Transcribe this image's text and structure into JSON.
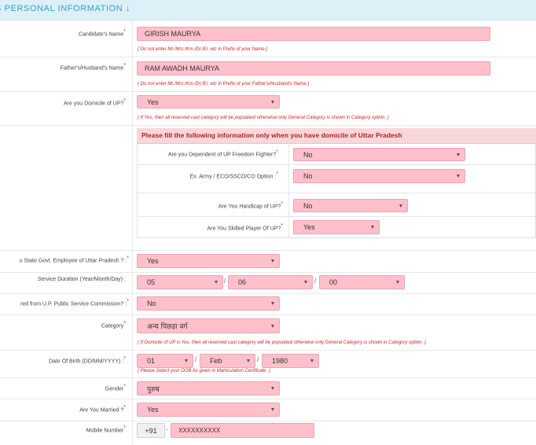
{
  "header": {
    "title": "S PERSONAL INFORMATION ↓"
  },
  "required_mark": "*",
  "candidate_name": {
    "label": "Candidate's Name",
    "value": "GIRISH MAURYA",
    "note": "( Do not enter Mr./Mrs./Km./Dr./Er. etc  in Prefix of your Name.)"
  },
  "father_name": {
    "label": "Father's/Husband's Name",
    "value": "RAM AWADH MAURYA",
    "note": "( Do not enter Mr./Mrs./Km./Dr./Er. etc  in Prefix of your Father's/Husband's Name.)"
  },
  "domicile": {
    "label": "Are you Domicile of UP?",
    "value": "Yes",
    "note": "( If Yes, then all reserved cast category will be populated otherwise only General Category is shown in Category option. )"
  },
  "domicile_panel": {
    "title": "Please fill the following information only when you have domicile of Uttar Pradesh",
    "freedom_fighter": {
      "label": "Are you Dependent of UP Freedom Fighter?",
      "value": "No"
    },
    "ex_army": {
      "label": "Ex. Army / ECO/SSCO/CO Option :",
      "value": "No"
    },
    "handicap": {
      "label": "Are You Handicap of UP?",
      "value": "No"
    },
    "skilled_player": {
      "label": "Are You Skilled Player Of UP?",
      "value": "Yes"
    }
  },
  "state_employee": {
    "label": "u State Govt. Employee of Uttar Pradesh ? :",
    "value": "Yes"
  },
  "service_duration": {
    "label": "Service Duration (Year/Month/Day) :",
    "year": "05",
    "month": "06",
    "day": "00",
    "sep": "/"
  },
  "uppsc": {
    "label": "red from U.P. Public Service Commission? :",
    "value": "No"
  },
  "category": {
    "label": "Category",
    "value": "अन्य पिछड़ा वर्ग",
    "note": "( If Domicile of UP is Yes, then all reserved cast category will be populated otherwise only General Category is shown in Category option. )"
  },
  "dob": {
    "label": "Date Of Birth (DD/MM/YYYY) :",
    "day": "01",
    "month": "Feb",
    "year": "1980",
    "sep": "/",
    "note": "( Please Select your DOB As given in Matriculation Certificate. )"
  },
  "gender": {
    "label": "Gender",
    "value": "पुरुष"
  },
  "married": {
    "label": "Are You Married ?",
    "value": "Yes"
  },
  "mobile": {
    "label": "Mobile Number",
    "prefix": "+91",
    "dash": "-",
    "value": "XXXXXXXXXX"
  }
}
